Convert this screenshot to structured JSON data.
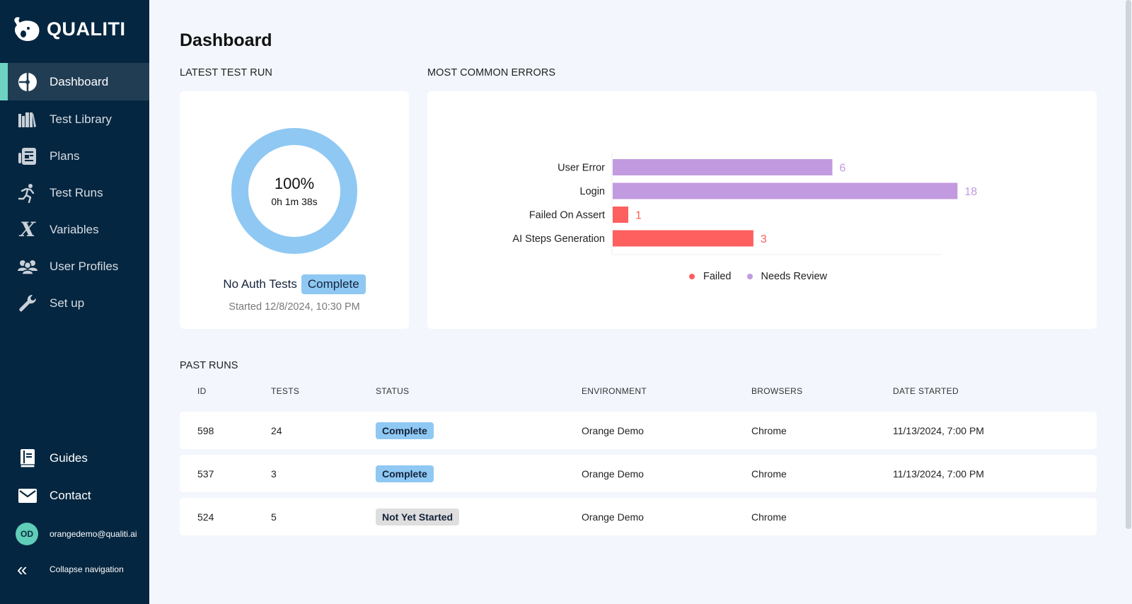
{
  "app": {
    "name": "QUALITI"
  },
  "sidebar": {
    "items": [
      {
        "label": "Dashboard",
        "icon": "dashboard-pie-icon",
        "active": true
      },
      {
        "label": "Test Library",
        "icon": "library-books-icon"
      },
      {
        "label": "Plans",
        "icon": "plans-newspaper-icon"
      },
      {
        "label": "Test Runs",
        "icon": "running-person-icon"
      },
      {
        "label": "Variables",
        "icon": "variable-x-icon"
      },
      {
        "label": "User Profiles",
        "icon": "users-group-icon"
      },
      {
        "label": "Set up",
        "icon": "wrench-icon"
      }
    ],
    "bottom": [
      {
        "label": "Guides",
        "icon": "guide-book-icon"
      },
      {
        "label": "Contact",
        "icon": "envelope-icon"
      }
    ],
    "user": {
      "initials": "OD",
      "email": "orangedemo@qualiti.ai"
    },
    "collapse_label": "Collapse navigation"
  },
  "page": {
    "title": "Dashboard"
  },
  "latest_run": {
    "section_label": "LATEST TEST RUN",
    "percent_label": "100%",
    "progress": 1.0,
    "duration": "0h 1m 38s",
    "name": "No Auth Tests",
    "status": "Complete",
    "started": "Started 12/8/2024, 10:30 PM",
    "ring_color": "#8fc8f3"
  },
  "errors": {
    "section_label": "MOST COMMON ERRORS"
  },
  "chart_data": {
    "type": "bar",
    "orientation": "horizontal",
    "title": "MOST COMMON ERRORS",
    "xscale": "log",
    "categories": [
      "User Error",
      "Login",
      "Failed On Assert",
      "AI Steps Generation"
    ],
    "values": [
      6,
      18,
      1,
      3
    ],
    "series_of": [
      "Needs Review",
      "Needs Review",
      "Failed",
      "Failed"
    ],
    "series": [
      {
        "name": "Failed",
        "color": "#fe5f5f"
      },
      {
        "name": "Needs Review",
        "color": "#c29ae0"
      }
    ],
    "legend": "bottom-center",
    "grid": false
  },
  "past_runs": {
    "section_label": "PAST RUNS",
    "columns": [
      "ID",
      "TESTS",
      "STATUS",
      "ENVIRONMENT",
      "BROWSERS",
      "DATE STARTED"
    ],
    "rows": [
      {
        "id": "598",
        "tests": "24",
        "status": "Complete",
        "environment": "Orange Demo",
        "browsers": "Chrome",
        "date": "11/13/2024, 7:00 PM"
      },
      {
        "id": "537",
        "tests": "3",
        "status": "Complete",
        "environment": "Orange Demo",
        "browsers": "Chrome",
        "date": "11/13/2024, 7:00 PM"
      },
      {
        "id": "524",
        "tests": "5",
        "status": "Not Yet Started",
        "environment": "Orange Demo",
        "browsers": "Chrome",
        "date": ""
      }
    ]
  }
}
